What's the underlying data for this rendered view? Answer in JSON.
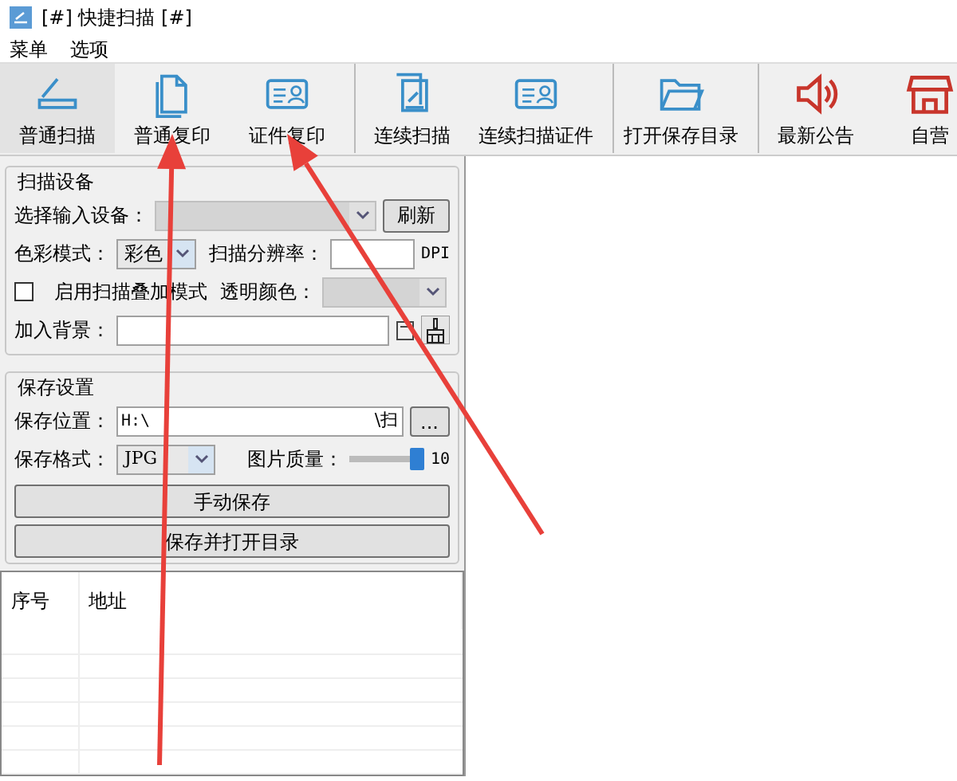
{
  "window": {
    "title": "[#] 快捷扫描 [#]"
  },
  "menu": [
    {
      "label": "菜单"
    },
    {
      "label": "选项"
    }
  ],
  "toolbar": [
    {
      "label": "普通扫描",
      "kind": "scanner",
      "selected": true,
      "arrowed": false,
      "separator_before": false
    },
    {
      "label": "普通复印",
      "kind": "document",
      "selected": false,
      "arrowed": true,
      "separator_before": false
    },
    {
      "label": "证件复印",
      "kind": "idcard",
      "selected": false,
      "arrowed": true,
      "separator_before": false
    },
    {
      "label": "连续扫描",
      "kind": "pages",
      "selected": false,
      "arrowed": false,
      "separator_before": true
    },
    {
      "label": "连续扫描证件",
      "kind": "idcard",
      "selected": false,
      "arrowed": false,
      "separator_before": false
    },
    {
      "label": "打开保存目录",
      "kind": "folder",
      "selected": false,
      "arrowed": false,
      "separator_before": true
    },
    {
      "label": "最新公告",
      "kind": "speaker",
      "selected": false,
      "arrowed": false,
      "separator_before": true
    },
    {
      "label": "自营",
      "kind": "store",
      "selected": false,
      "arrowed": false,
      "separator_before": false
    }
  ],
  "scan_device": {
    "title": "扫描设备",
    "device_label": "选择输入设备：",
    "device_disabled": true,
    "refresh_button": "刷新",
    "color_mode_label": "色彩模式：",
    "color_mode": "彩色",
    "resolution_label": "扫描分辨率：",
    "dpi_unit": "DPI",
    "overlay_checkbox": {
      "label": "启用扫描叠加模式",
      "checked": false
    },
    "transparent_label": "透明颜色：",
    "transparent_disabled": true,
    "background_label": "加入背景："
  },
  "save_settings": {
    "title": "保存设置",
    "location_label": "保存位置：",
    "location_value": "H:\\",
    "location_end": "\\扫",
    "browse_button": "...",
    "format_label": "保存格式：",
    "format": "JPG",
    "quality_label": "图片质量：",
    "quality": {
      "level": 1.0,
      "reading": "10"
    },
    "buttons": [
      "手动保存",
      "保存并打开目录"
    ]
  },
  "table": {
    "columns": [
      "序号",
      "地址"
    ]
  }
}
